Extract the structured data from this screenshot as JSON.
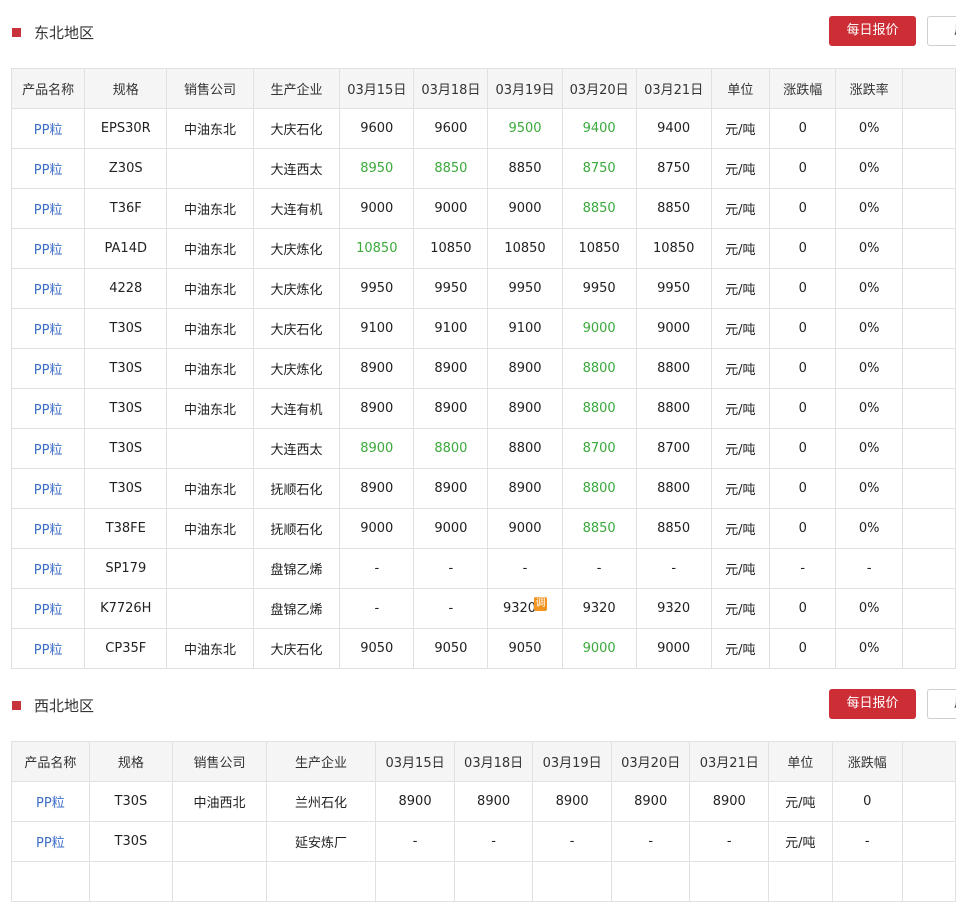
{
  "sections": [
    {
      "title": "东北地区",
      "daily_btn": "每日报价",
      "other_btn": "周",
      "headers": [
        "产品名称",
        "规格",
        "销售公司",
        "生产企业",
        "03月15日",
        "03月18日",
        "03月19日",
        "03月20日",
        "03月21日",
        "单位",
        "涨跌幅",
        "涨跌率",
        ""
      ],
      "rows": [
        {
          "cells": [
            "PP粒",
            "EPS30R",
            "中油东北",
            "大庆石化",
            "9600",
            "9600",
            "9500",
            "9400",
            "9400",
            "元/吨",
            "0",
            "0%",
            ""
          ],
          "green": [
            6,
            7
          ]
        },
        {
          "cells": [
            "PP粒",
            "Z30S",
            "",
            "大连西太",
            "8950",
            "8850",
            "8850",
            "8750",
            "8750",
            "元/吨",
            "0",
            "0%",
            ""
          ],
          "green": [
            4,
            5,
            7
          ]
        },
        {
          "cells": [
            "PP粒",
            "T36F",
            "中油东北",
            "大连有机",
            "9000",
            "9000",
            "9000",
            "8850",
            "8850",
            "元/吨",
            "0",
            "0%",
            ""
          ],
          "green": [
            7
          ]
        },
        {
          "cells": [
            "PP粒",
            "PA14D",
            "中油东北",
            "大庆炼化",
            "10850",
            "10850",
            "10850",
            "10850",
            "10850",
            "元/吨",
            "0",
            "0%",
            ""
          ],
          "green": [
            4
          ]
        },
        {
          "cells": [
            "PP粒",
            "4228",
            "中油东北",
            "大庆炼化",
            "9950",
            "9950",
            "9950",
            "9950",
            "9950",
            "元/吨",
            "0",
            "0%",
            ""
          ],
          "green": []
        },
        {
          "cells": [
            "PP粒",
            "T30S",
            "中油东北",
            "大庆石化",
            "9100",
            "9100",
            "9100",
            "9000",
            "9000",
            "元/吨",
            "0",
            "0%",
            ""
          ],
          "green": [
            7
          ]
        },
        {
          "cells": [
            "PP粒",
            "T30S",
            "中油东北",
            "大庆炼化",
            "8900",
            "8900",
            "8900",
            "8800",
            "8800",
            "元/吨",
            "0",
            "0%",
            ""
          ],
          "green": [
            7
          ]
        },
        {
          "cells": [
            "PP粒",
            "T30S",
            "中油东北",
            "大连有机",
            "8900",
            "8900",
            "8900",
            "8800",
            "8800",
            "元/吨",
            "0",
            "0%",
            ""
          ],
          "green": [
            7
          ]
        },
        {
          "cells": [
            "PP粒",
            "T30S",
            "",
            "大连西太",
            "8900",
            "8800",
            "8800",
            "8700",
            "8700",
            "元/吨",
            "0",
            "0%",
            ""
          ],
          "green": [
            4,
            5,
            7
          ]
        },
        {
          "cells": [
            "PP粒",
            "T30S",
            "中油东北",
            "抚顺石化",
            "8900",
            "8900",
            "8900",
            "8800",
            "8800",
            "元/吨",
            "0",
            "0%",
            ""
          ],
          "green": [
            7
          ]
        },
        {
          "cells": [
            "PP粒",
            "T38FE",
            "中油东北",
            "抚顺石化",
            "9000",
            "9000",
            "9000",
            "8850",
            "8850",
            "元/吨",
            "0",
            "0%",
            ""
          ],
          "green": [
            7
          ]
        },
        {
          "cells": [
            "PP粒",
            "SP179",
            "",
            "盘锦乙烯",
            "-",
            "-",
            "-",
            "-",
            "-",
            "元/吨",
            "-",
            "-",
            ""
          ],
          "green": []
        },
        {
          "cells": [
            "PP粒",
            "K7726H",
            "",
            "盘锦乙烯",
            "-",
            "-",
            "9320",
            "9320",
            "9320",
            "元/吨",
            "0",
            "0%",
            ""
          ],
          "green": [],
          "badge_col": 6,
          "badge": "调"
        },
        {
          "cells": [
            "PP粒",
            "CP35F",
            "中油东北",
            "大庆石化",
            "9050",
            "9050",
            "9050",
            "9000",
            "9000",
            "元/吨",
            "0",
            "0%",
            ""
          ],
          "green": [
            7
          ]
        }
      ]
    },
    {
      "title": "西北地区",
      "daily_btn": "每日报价",
      "other_btn": "周",
      "headers": [
        "产品名称",
        "规格",
        "销售公司",
        "生产企业",
        "03月15日",
        "03月18日",
        "03月19日",
        "03月20日",
        "03月21日",
        "单位",
        "涨跌幅",
        ""
      ],
      "rows": [
        {
          "cells": [
            "PP粒",
            "T30S",
            "中油西北",
            "兰州石化",
            "8900",
            "8900",
            "8900",
            "8900",
            "8900",
            "元/吨",
            "0",
            ""
          ],
          "green": []
        },
        {
          "cells": [
            "PP粒",
            "T30S",
            "",
            "延安炼厂",
            "-",
            "-",
            "-",
            "-",
            "-",
            "元/吨",
            "-",
            ""
          ],
          "green": []
        },
        {
          "cells": [
            "",
            "",
            "",
            "",
            "",
            "",
            "",
            "",
            "",
            "",
            "",
            ""
          ],
          "green": []
        }
      ]
    }
  ],
  "colors": {
    "accent": "#cd2e36",
    "product_link": "#3c6dc7",
    "price_change": "#3aa93a",
    "badge": "#f29420"
  }
}
